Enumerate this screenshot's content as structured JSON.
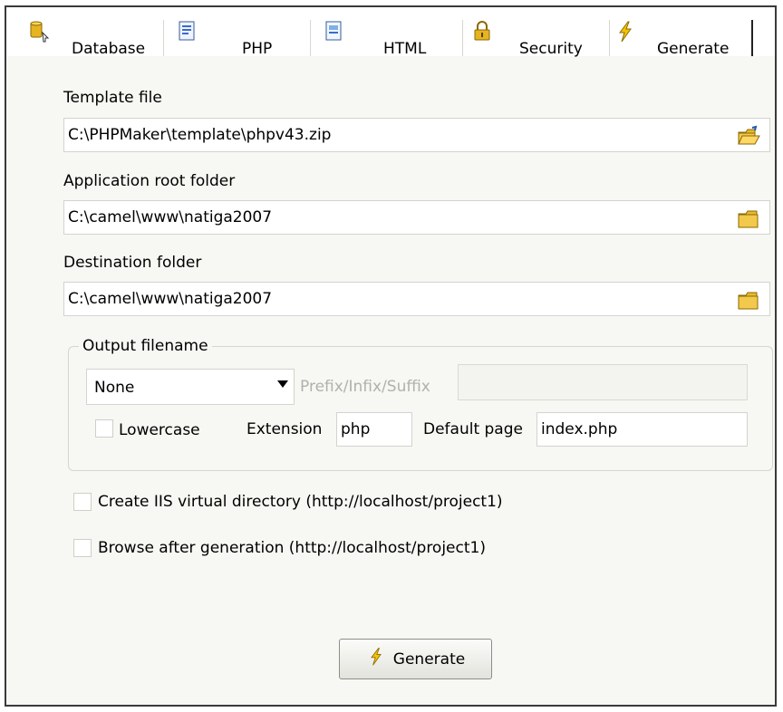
{
  "tabs": [
    {
      "label": "Database",
      "icon": "database-icon"
    },
    {
      "label": "PHP",
      "icon": "php-file-icon"
    },
    {
      "label": "HTML",
      "icon": "html-file-icon"
    },
    {
      "label": "Security",
      "icon": "lock-icon"
    },
    {
      "label": "Generate",
      "icon": "lightning-icon",
      "active": true
    }
  ],
  "template": {
    "label": "Template file",
    "value": "C:\\PHPMaker\\template\\phpv43.zip"
  },
  "app_root": {
    "label": "Application root folder",
    "value": "C:\\camel\\www\\natiga2007"
  },
  "destination": {
    "label": "Destination folder",
    "value": "C:\\camel\\www\\natiga2007"
  },
  "output": {
    "legend": "Output filename",
    "mode": "None",
    "prefix_label": "Prefix/Infix/Suffix",
    "prefix_value": "",
    "lowercase_label": "Lowercase",
    "lowercase_checked": false,
    "extension_label": "Extension",
    "extension_value": "php",
    "default_page_label": "Default page",
    "default_page_value": "index.php"
  },
  "options": {
    "iis_label": "Create IIS virtual directory (http://localhost/project1)",
    "iis_checked": false,
    "browse_label": "Browse after generation (http://localhost/project1)",
    "browse_checked": false
  },
  "generate_button": "Generate",
  "colors": {
    "folder": "#f2c94c",
    "folder_dark": "#b8860b",
    "accent": "#e0b000"
  }
}
